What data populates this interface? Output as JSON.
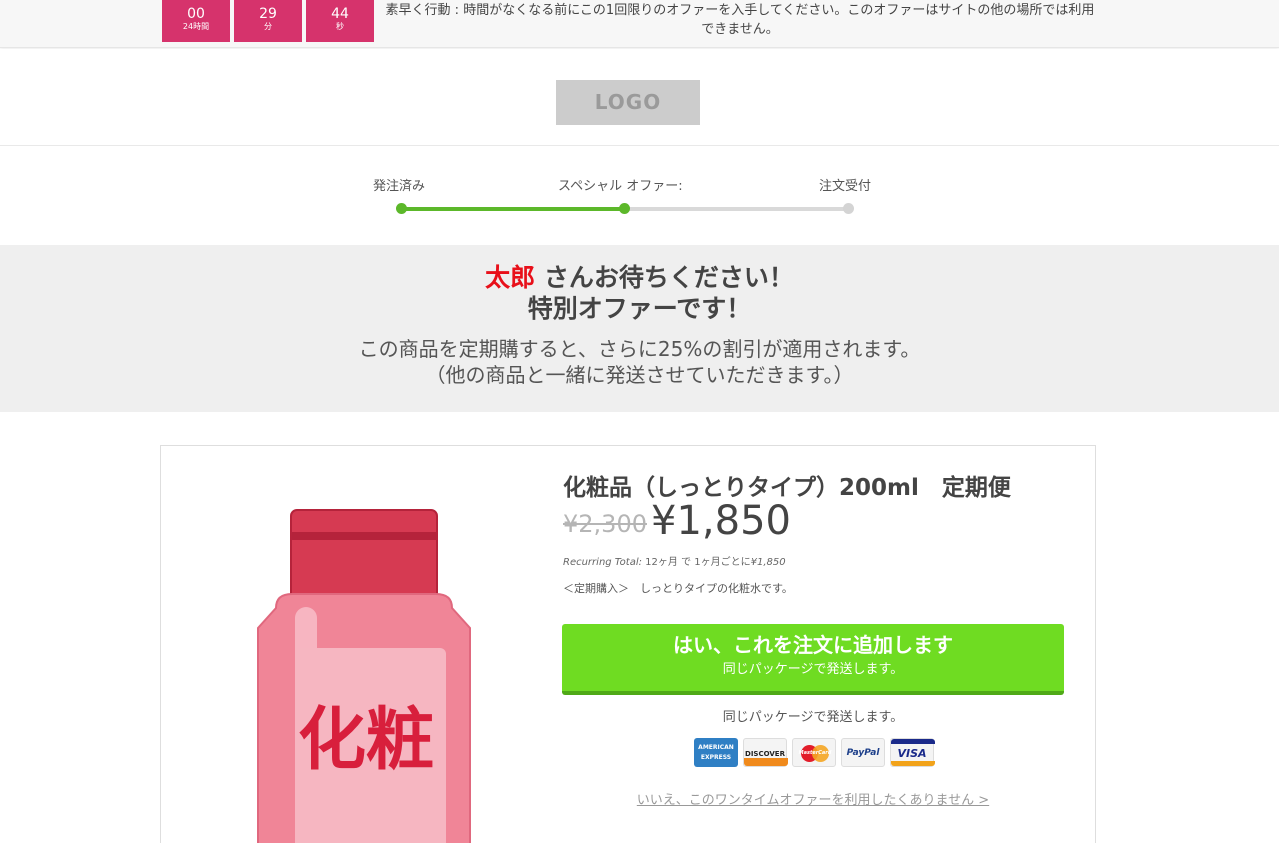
{
  "countdown": {
    "boxes": [
      {
        "value": "00",
        "unit": "24時間"
      },
      {
        "value": "29",
        "unit": "分"
      },
      {
        "value": "44",
        "unit": "秒"
      }
    ],
    "message": "素早く行動 : 時間がなくなる前にこの1回限りのオファーを入手してください。このオファーはサイトの他の場所では利用できません。",
    "color": "#d6336c"
  },
  "header": {
    "logo_text": "LOGO"
  },
  "progress": {
    "steps": [
      {
        "label": "発注済み",
        "state": "done"
      },
      {
        "label": "スペシャル オファー:",
        "state": "current"
      },
      {
        "label": "注文受付",
        "state": "todo"
      }
    ],
    "completed_fraction": 0.5,
    "active_color": "#5cb82a"
  },
  "banner": {
    "customer_name": "太郎",
    "greeting_suffix": " さんお待ちください！",
    "title": "特別オファーです！",
    "description_line1": "この商品を定期購すると、さらに25%の割引が適用されます。",
    "description_line2": "（他の商品と一緒に発送させていただきます。）"
  },
  "product": {
    "image_icon": "lotion-bottle-icon",
    "image_label": "化粧",
    "title": "化粧品（しっとりタイプ）200ml　定期便",
    "old_price": "¥2,300",
    "new_price": "¥1,850",
    "recurring_label": "Recurring Total:",
    "recurring_text": " 12ヶ月 で 1ヶ月ごとに",
    "recurring_amount": "¥1,850",
    "description": "＜定期購入＞　しっとりタイプの化粧水です。",
    "cta_main": "はい、これを注文に追加します",
    "cta_sub": "同じパッケージで発送します。",
    "ship_note": "同じパッケージで発送します。",
    "payment_methods": [
      {
        "name": "AMERICAN EXPRESS",
        "icon": "amex-card-icon"
      },
      {
        "name": "DISCOVER",
        "icon": "discover-card-icon"
      },
      {
        "name": "MasterCard",
        "icon": "mastercard-icon"
      },
      {
        "name": "PayPal",
        "icon": "paypal-icon"
      },
      {
        "name": "VISA",
        "icon": "visa-card-icon"
      }
    ],
    "decline_link": "いいえ、このワンタイムオファーを利用したくありません >",
    "cta_color": "#6fdc22"
  }
}
